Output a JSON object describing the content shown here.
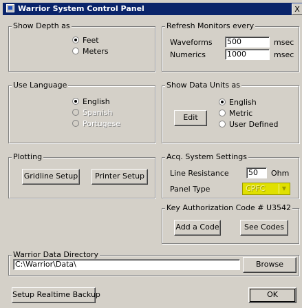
{
  "window": {
    "title": "Warrior System Control Panel",
    "close_label": "X"
  },
  "depth": {
    "legend": "Show Depth as",
    "options": [
      {
        "label": "Feet",
        "selected": true
      },
      {
        "label": "Meters",
        "selected": false
      }
    ]
  },
  "refresh": {
    "legend": "Refresh Monitors every",
    "waveforms_label": "Waveforms",
    "waveforms_value": "500",
    "waveforms_unit": "msec",
    "numerics_label": "Numerics",
    "numerics_value": "1000",
    "numerics_unit": "msec"
  },
  "language": {
    "legend": "Use Language",
    "options": [
      {
        "label": "English",
        "selected": true,
        "enabled": true
      },
      {
        "label": "Spanish",
        "selected": false,
        "enabled": false
      },
      {
        "label": "Portugese",
        "selected": false,
        "enabled": false
      }
    ]
  },
  "units": {
    "legend": "Show Data Units as",
    "edit_label": "Edit",
    "options": [
      {
        "label": "English",
        "selected": true
      },
      {
        "label": "Metric",
        "selected": false
      },
      {
        "label": "User Defined",
        "selected": false
      }
    ]
  },
  "plotting": {
    "legend": "Plotting",
    "gridline_label": "Gridline Setup",
    "printer_label": "Printer Setup"
  },
  "acq": {
    "legend": "Acq. System Settings",
    "line_resistance_label": "Line Resistance",
    "line_resistance_value": "50",
    "line_resistance_unit": "Ohm",
    "panel_type_label": "Panel Type",
    "panel_type_value": "CPFC",
    "panel_type_highlight": "#e0e000"
  },
  "auth": {
    "legend": "Key Authorization Code  # U3542",
    "add_label": "Add a Code",
    "see_label": "See Codes"
  },
  "directory": {
    "legend": "Warrior Data Directory",
    "path": "C:\\Warrior\\Data\\",
    "browse_label": "Browse"
  },
  "footer": {
    "backup_label": "Setup Realtime Backup",
    "ok_label": "OK"
  },
  "colors": {
    "title_bar": "#0a246a",
    "face": "#d4d0c8"
  }
}
